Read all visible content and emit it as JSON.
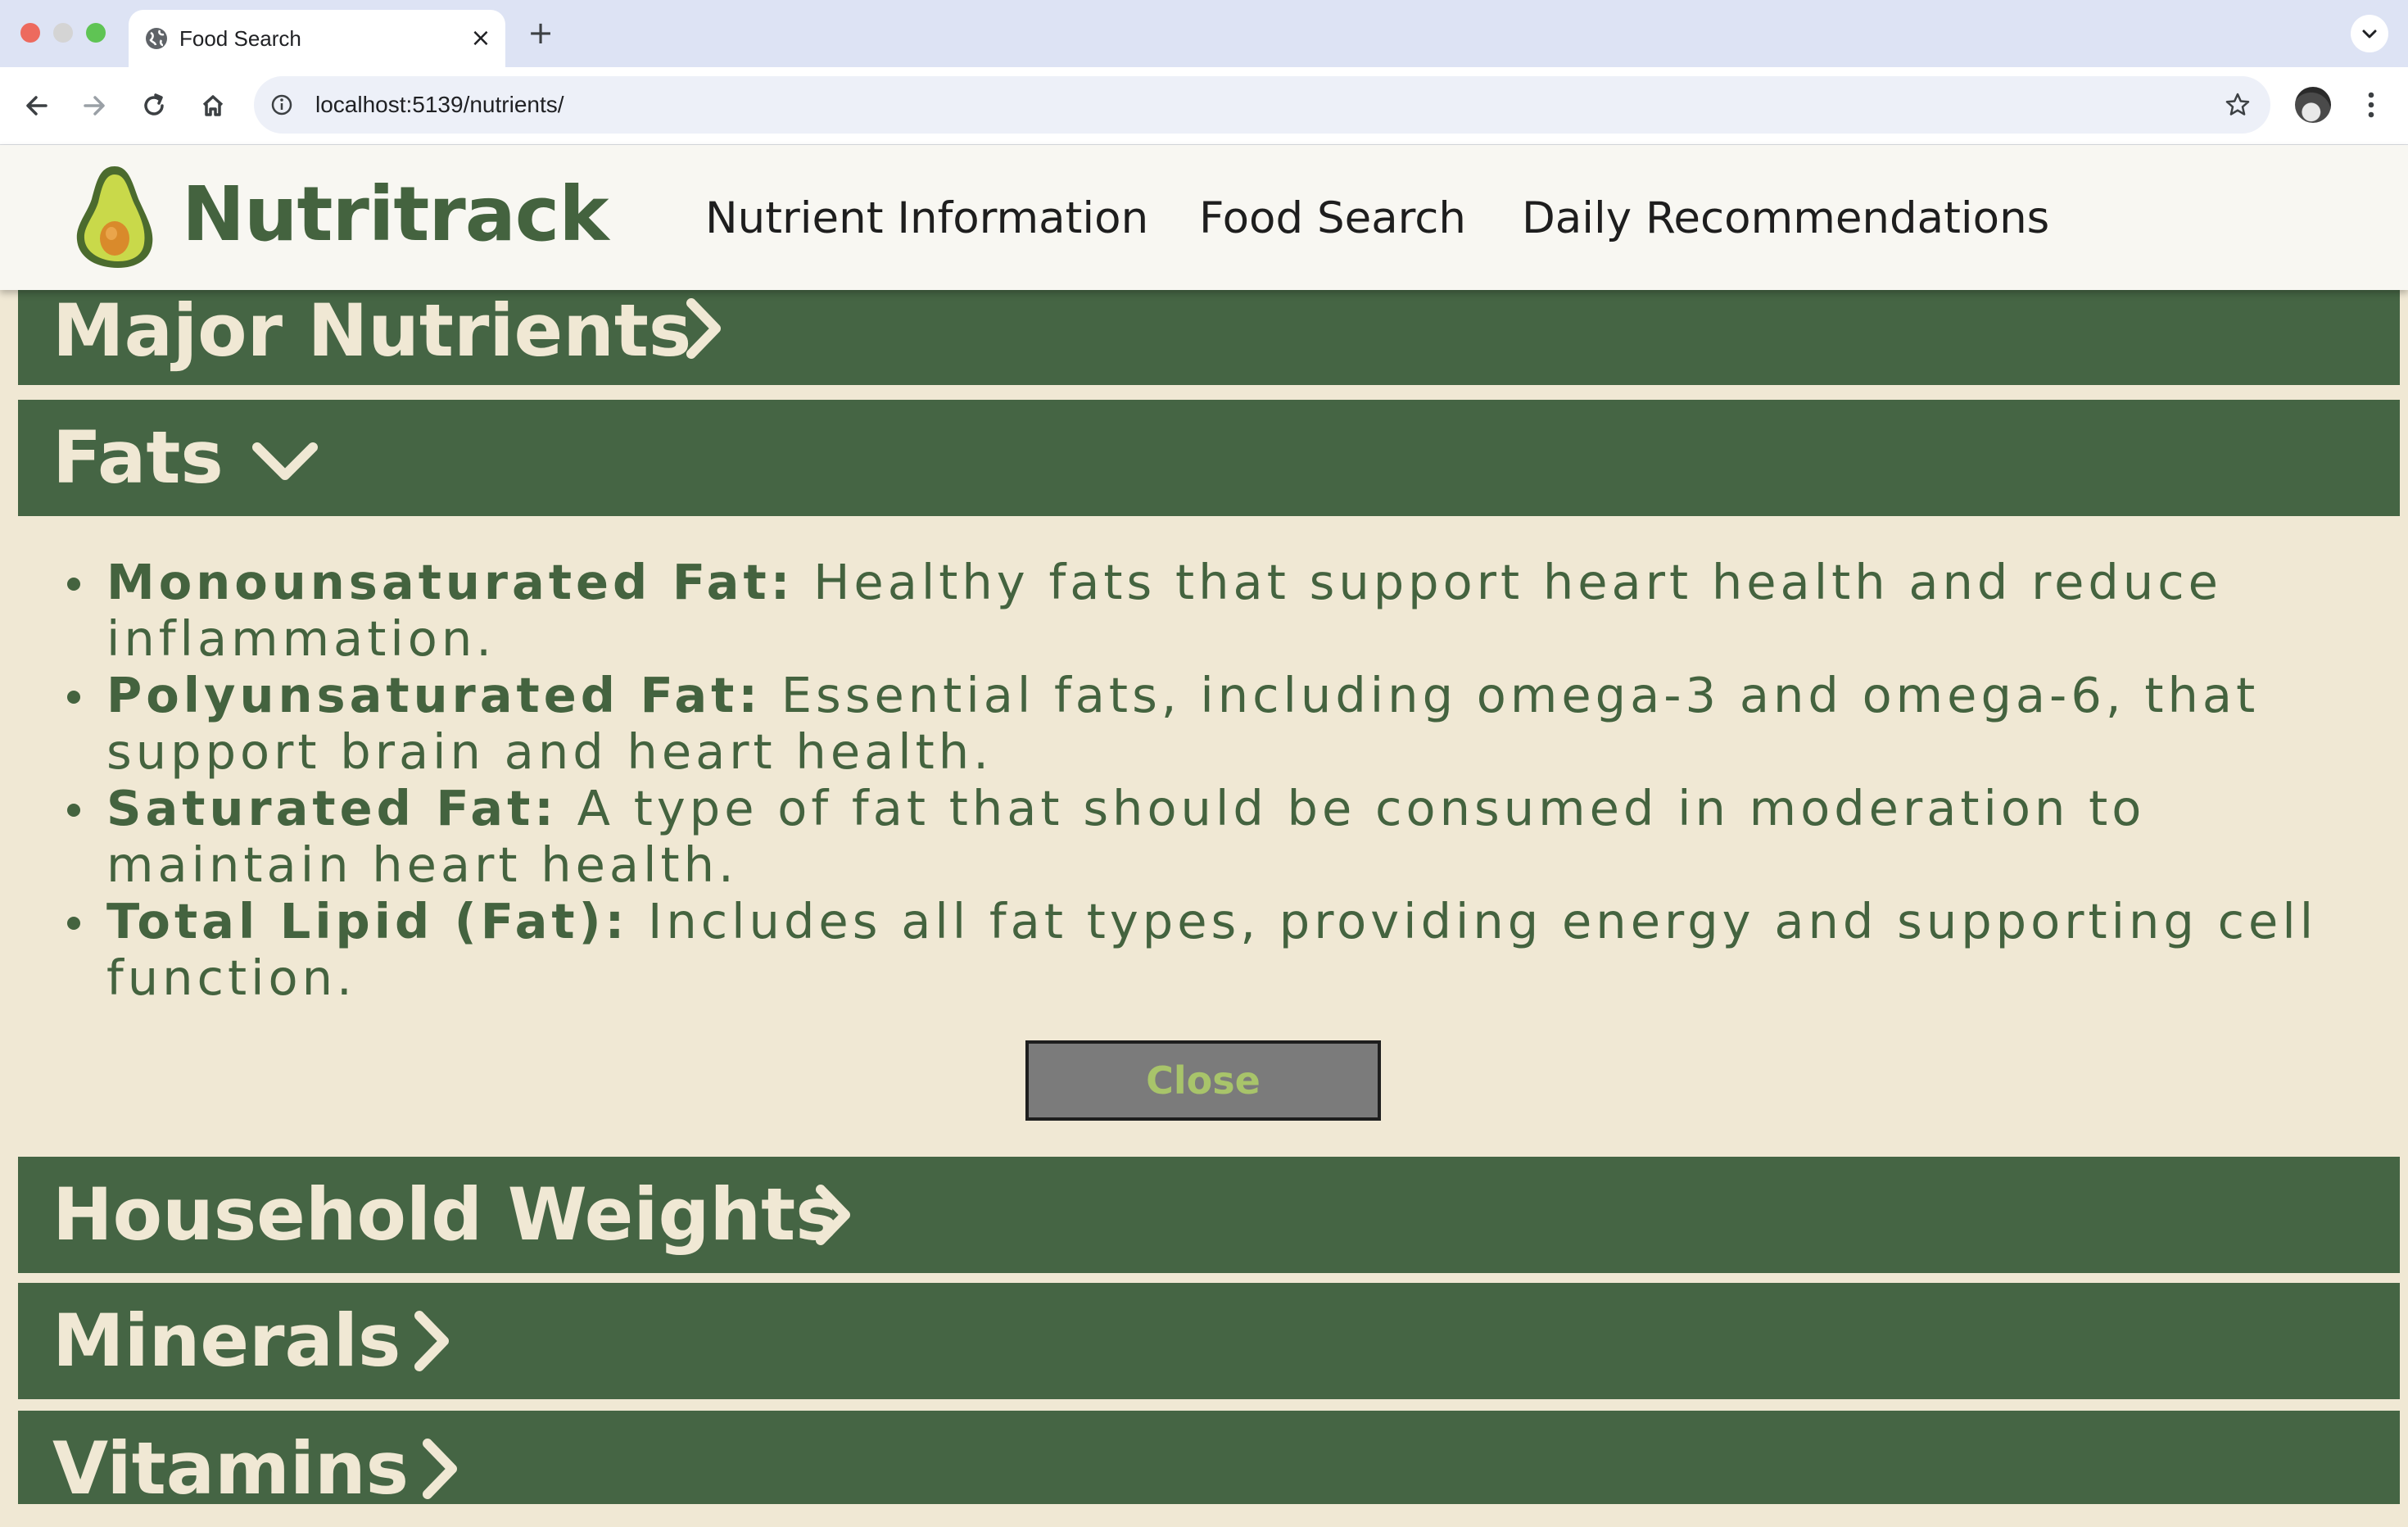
{
  "browser": {
    "tab_title": "Food Search",
    "url": "localhost:5139/nutrients/"
  },
  "site": {
    "logo_text": "Nutritrack",
    "nav": [
      {
        "label": "Nutrient Information"
      },
      {
        "label": "Food Search"
      },
      {
        "label": "Daily Recommendations"
      }
    ]
  },
  "sections": [
    {
      "title": "Major Nutrients",
      "expanded": false
    },
    {
      "title": "Fats",
      "expanded": true
    },
    {
      "title": "Household Weights",
      "expanded": false
    },
    {
      "title": "Minerals",
      "expanded": false
    },
    {
      "title": "Vitamins",
      "expanded": false
    }
  ],
  "fats": {
    "items": [
      {
        "name": "Monounsaturated Fat:",
        "desc": "Healthy fats that support heart health and reduce inflammation."
      },
      {
        "name": "Polyunsaturated Fat:",
        "desc": "Essential fats, including omega-3 and omega-6, that support brain and heart health."
      },
      {
        "name": "Saturated Fat:",
        "desc": "A type of fat that should be consumed in moderation to maintain heart health."
      },
      {
        "name": "Total Lipid (Fat):",
        "desc": "Includes all fat types, providing energy and supporting cell function."
      }
    ],
    "close_label": "Close"
  },
  "colors": {
    "section_bar": "#456544",
    "page_bg": "#f0e8d4",
    "text_green": "#44633f"
  },
  "icons": [
    "globe-icon",
    "close-icon",
    "plus-icon",
    "back-icon",
    "forward-icon",
    "reload-icon",
    "home-icon",
    "info-icon",
    "star-icon",
    "more-icon",
    "avocado-logo-icon",
    "chevron-right-icon",
    "chevron-down-icon"
  ]
}
